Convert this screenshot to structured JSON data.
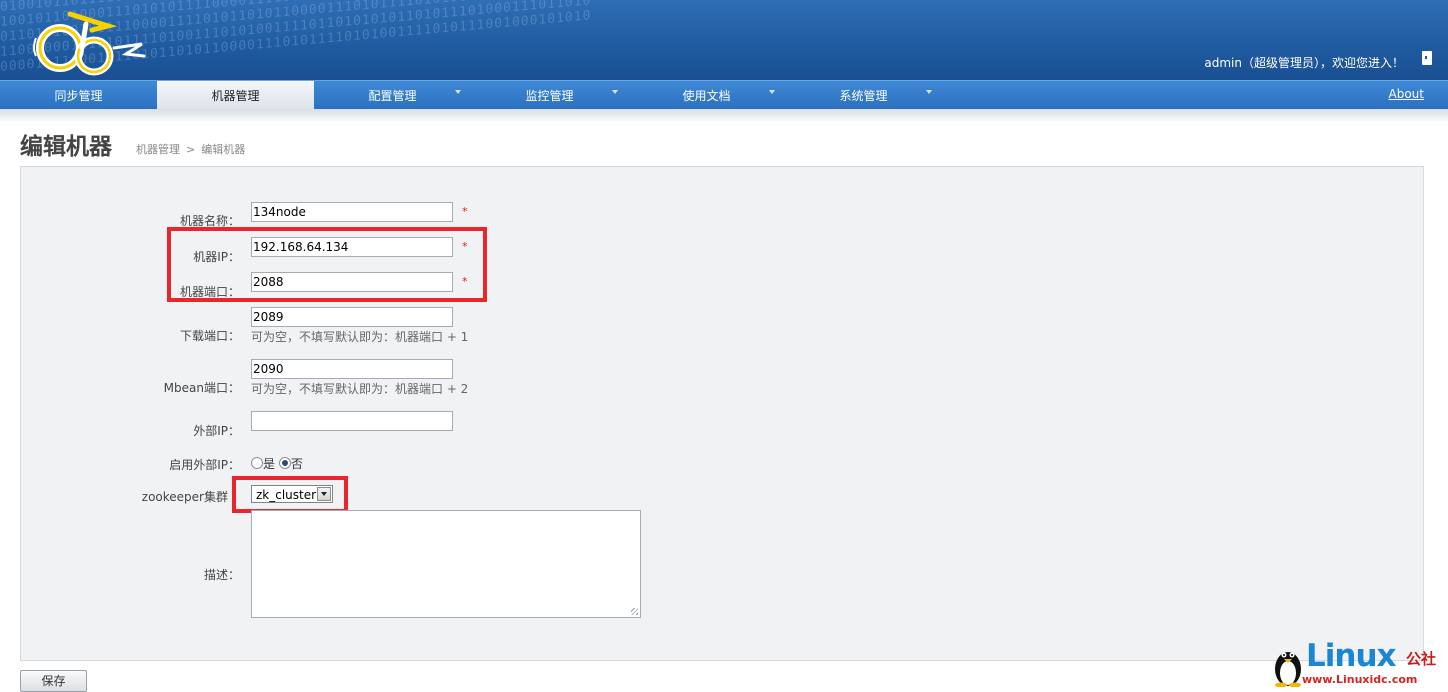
{
  "header": {
    "user_welcome": "admin（超级管理员），欢迎您进入！",
    "binary_text": "01001011011110101101101101001001110110101001111010111001000101010010\n10010110100011101010111100001111010110101100001110101111010100111101\n0110101001011110000111101011010110000111010111101010011110110101010\n1100100011101011110100111010100111101101010101101011101000111011010\n0000111100011110101101011000011101011110101001111010111001000101010"
  },
  "nav": {
    "items": [
      {
        "label": "同步管理",
        "has_dropdown": false
      },
      {
        "label": "机器管理",
        "has_dropdown": false,
        "active": true
      },
      {
        "label": "配置管理",
        "has_dropdown": true
      },
      {
        "label": "监控管理",
        "has_dropdown": true
      },
      {
        "label": "使用文档",
        "has_dropdown": true
      },
      {
        "label": "系统管理",
        "has_dropdown": true
      }
    ],
    "about": "About"
  },
  "page": {
    "title": "编辑机器",
    "breadcrumb": [
      "机器管理",
      ">",
      "编辑机器"
    ]
  },
  "form": {
    "name": {
      "label": "机器名称：",
      "value": "134node",
      "required": "*"
    },
    "ip": {
      "label": "机器IP：",
      "value": "192.168.64.134",
      "required": "*"
    },
    "port": {
      "label": "机器端口：",
      "value": "2088",
      "required": "*"
    },
    "download_port": {
      "label": "下载端口：",
      "value": "2089",
      "hint": "可为空，不填写默认即为：机器端口 + 1"
    },
    "mbean_port": {
      "label": "Mbean端口：",
      "value": "2090",
      "hint": "可为空，不填写默认即为：机器端口 + 2"
    },
    "external_ip": {
      "label": "外部IP：",
      "value": ""
    },
    "use_external_ip": {
      "label": "启用外部IP：",
      "options": [
        "是",
        "否"
      ],
      "selected": "否"
    },
    "zookeeper": {
      "label": "zookeeper集群",
      "selected": "zk_cluster"
    },
    "description": {
      "label": "描述：",
      "value": ""
    }
  },
  "actions": {
    "save": "保存"
  },
  "watermark": {
    "word": "Linux",
    "cn": "公社",
    "url": "www.Linuxidc.com"
  },
  "colors": {
    "highlight": "#e8262b",
    "header": "#1f5aa0",
    "nav": "#2a6fbf"
  }
}
